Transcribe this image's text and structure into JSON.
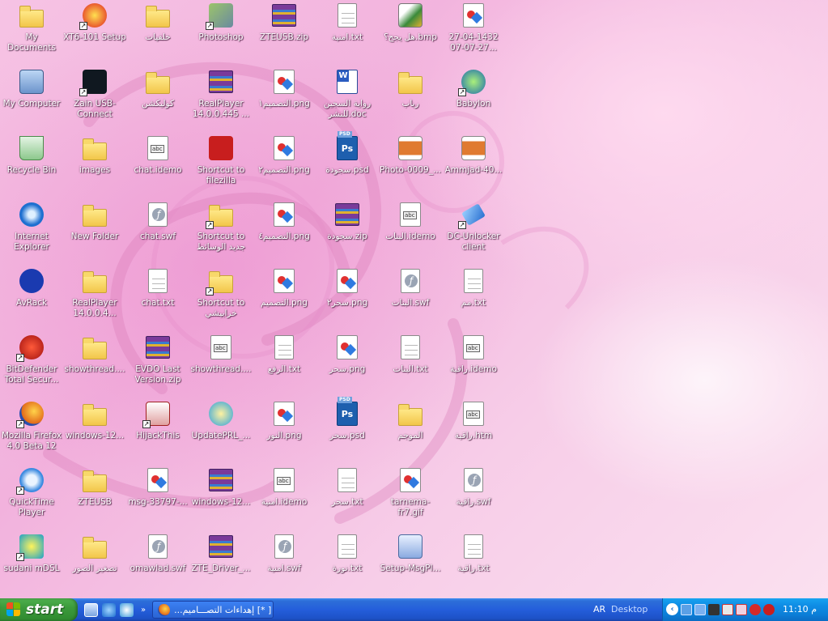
{
  "desktop": {
    "columns": [
      [
        {
          "label": "My Documents",
          "icon": "my-documents-icon",
          "type": "folder"
        },
        {
          "label": "My Computer",
          "icon": "my-computer-icon",
          "type": "computer"
        },
        {
          "label": "Recycle Bin",
          "icon": "recycle-bin-icon",
          "type": "recycle"
        },
        {
          "label": "Internet Explorer",
          "icon": "internet-explorer-icon",
          "type": "ie"
        },
        {
          "label": "AvRack",
          "icon": "avrack-icon",
          "type": "avrack"
        },
        {
          "label": "BitDefender Total Secur...",
          "icon": "bitdefender-icon",
          "type": "bitdefender",
          "shortcut": true
        },
        {
          "label": "Mozilla Firefox 4.0 Beta 12",
          "icon": "firefox-icon",
          "type": "firefox",
          "shortcut": true
        },
        {
          "label": "QuickTime Player",
          "icon": "quicktime-icon",
          "type": "quicktime",
          "shortcut": true
        },
        {
          "label": "sudani mDSL",
          "icon": "sudani-icon",
          "type": "sudani",
          "shortcut": true
        }
      ],
      [
        {
          "label": "XT6-101 Setup",
          "icon": "setup-app-icon",
          "type": "xt6",
          "shortcut": true
        },
        {
          "label": "Zain USB-Connect",
          "icon": "zain-icon",
          "type": "zain",
          "shortcut": true
        },
        {
          "label": "images",
          "icon": "folder-icon",
          "type": "folder"
        },
        {
          "label": "New Folder",
          "icon": "folder-icon",
          "type": "folder"
        },
        {
          "label": "RealPlayer 14.0.0.4...",
          "icon": "folder-icon",
          "type": "folder"
        },
        {
          "label": "showthread....",
          "icon": "folder-icon",
          "type": "folder"
        },
        {
          "label": "windows-12...",
          "icon": "folder-icon",
          "type": "folder"
        },
        {
          "label": "ZTEUSB",
          "icon": "folder-icon",
          "type": "folder"
        },
        {
          "label": "تصغير الصور",
          "icon": "folder-icon",
          "type": "folder"
        }
      ],
      [
        {
          "label": "خلفيات",
          "icon": "folder-icon",
          "type": "folder"
        },
        {
          "label": "كوليكشن",
          "icon": "folder-icon",
          "type": "folder"
        },
        {
          "label": "chat.idemo",
          "icon": "idemo-file-icon",
          "type": "idemo"
        },
        {
          "label": "chat.swf",
          "icon": "swf-file-icon",
          "type": "swf"
        },
        {
          "label": "chat.txt",
          "icon": "text-file-icon",
          "type": "txt"
        },
        {
          "label": "EVDO Last Version.zip",
          "icon": "archive-icon",
          "type": "rar"
        },
        {
          "label": "HijackThis",
          "icon": "hijackthis-icon",
          "type": "hijack",
          "shortcut": true
        },
        {
          "label": "msg-33797-...",
          "icon": "image-file-icon",
          "type": "png"
        },
        {
          "label": "omawlad.swf",
          "icon": "swf-file-icon",
          "type": "swf"
        }
      ],
      [
        {
          "label": "Photoshop",
          "icon": "photoshop-icon",
          "type": "photoshop",
          "shortcut": true
        },
        {
          "label": "RealPlayer 14.0.0.445 ...",
          "icon": "archive-icon",
          "type": "rar"
        },
        {
          "label": "Shortcut to filezilla",
          "icon": "filezilla-icon",
          "type": "filezilla"
        },
        {
          "label": "Shortcut to جديد الوسائط",
          "icon": "folder-icon",
          "type": "folder",
          "shortcut": true
        },
        {
          "label": "Shortcut to خرابيشي",
          "icon": "folder-icon",
          "type": "folder",
          "shortcut": true
        },
        {
          "label": "showthread....",
          "icon": "idemo-file-icon",
          "type": "idemo"
        },
        {
          "label": "UpdatePRL_...",
          "icon": "update-app-icon",
          "type": "update"
        },
        {
          "label": "windows-12...",
          "icon": "archive-icon",
          "type": "rar"
        },
        {
          "label": "ZTE_Driver_...",
          "icon": "archive-icon",
          "type": "rar"
        }
      ],
      [
        {
          "label": "ZTEUSB.zip",
          "icon": "archive-icon",
          "type": "rar"
        },
        {
          "label": "التصميم۱.png",
          "icon": "image-file-icon",
          "type": "png"
        },
        {
          "label": "التصميم۲.png",
          "icon": "image-file-icon",
          "type": "png"
        },
        {
          "label": "التصميم٤.png",
          "icon": "image-file-icon",
          "type": "png"
        },
        {
          "label": "التصميم.png",
          "icon": "image-file-icon",
          "type": "png"
        },
        {
          "label": "الرفع.txt",
          "icon": "text-file-icon",
          "type": "txt"
        },
        {
          "label": "النور.png",
          "icon": "image-file-icon",
          "type": "png"
        },
        {
          "label": "امنية.idemo",
          "icon": "idemo-file-icon",
          "type": "idemo"
        },
        {
          "label": "امنية.swf",
          "icon": "swf-file-icon",
          "type": "swf"
        }
      ],
      [
        {
          "label": "امنية.txt",
          "icon": "text-file-icon",
          "type": "txt"
        },
        {
          "label": "رواية السجين للنشر.doc",
          "icon": "word-doc-icon",
          "type": "doc"
        },
        {
          "label": "سجودة.psd",
          "icon": "psd-file-icon",
          "type": "psd"
        },
        {
          "label": "سجودة.zip",
          "icon": "archive-icon",
          "type": "rar"
        },
        {
          "label": "سحر۲.png",
          "icon": "image-file-icon",
          "type": "png"
        },
        {
          "label": "سحر.png",
          "icon": "image-file-icon",
          "type": "png"
        },
        {
          "label": "سحر.psd",
          "icon": "psd-file-icon",
          "type": "psd"
        },
        {
          "label": "سحر.txt",
          "icon": "text-file-icon",
          "type": "txt"
        },
        {
          "label": "نورة.txt",
          "icon": "text-file-icon",
          "type": "txt"
        }
      ],
      [
        {
          "label": "هل يجح؟.bmp",
          "icon": "paint-file-icon",
          "type": "bmp"
        },
        {
          "label": "رباب",
          "icon": "folder-icon",
          "type": "folder"
        },
        {
          "label": "Photo-0009_...",
          "icon": "photo-file-icon",
          "type": "photo"
        },
        {
          "label": "البنات.idemo",
          "icon": "idemo-file-icon",
          "type": "idemo"
        },
        {
          "label": "البنات.swf",
          "icon": "swf-file-icon",
          "type": "swf"
        },
        {
          "label": "البنات.txt",
          "icon": "text-file-icon",
          "type": "txt"
        },
        {
          "label": "الموجم",
          "icon": "folder-icon",
          "type": "folder"
        },
        {
          "label": "tarnema-fr7.gif",
          "icon": "image-file-icon",
          "type": "png"
        },
        {
          "label": "Setup-MsgPl...",
          "icon": "setup-app-icon",
          "type": "msgsetup"
        }
      ],
      [
        {
          "label": "27-04-1432 07-07-27...",
          "icon": "image-file-icon",
          "type": "png"
        },
        {
          "label": "Babylon",
          "icon": "babylon-icon",
          "type": "babylon",
          "shortcut": true
        },
        {
          "label": "Ammjad-40...",
          "icon": "photo-file-icon",
          "type": "photo"
        },
        {
          "label": "DC-Unlocker client",
          "icon": "dc-unlocker-icon",
          "type": "dcunlock",
          "shortcut": true
        },
        {
          "label": "مم.txt",
          "icon": "text-file-icon",
          "type": "txt"
        },
        {
          "label": "راقية.idemo",
          "icon": "idemo-file-icon",
          "type": "idemo"
        },
        {
          "label": "راقية.htm",
          "icon": "html-file-icon",
          "type": "idemo"
        },
        {
          "label": "راقية.swf",
          "icon": "swf-file-icon",
          "type": "swf"
        },
        {
          "label": "راقية.txt",
          "icon": "text-file-icon",
          "type": "txt"
        }
      ]
    ]
  },
  "taskbar": {
    "start_label": "start",
    "active_task": "[ *] إهداءات التصـــاميم...",
    "language": "AR",
    "desktop_toolbar": "Desktop",
    "clock": "11:10 م"
  },
  "colors": {
    "taskbar": "#245edb",
    "start": "#3c9a3c",
    "tray": "#0f8ee6",
    "wallpaper": "#f4bfe2"
  }
}
